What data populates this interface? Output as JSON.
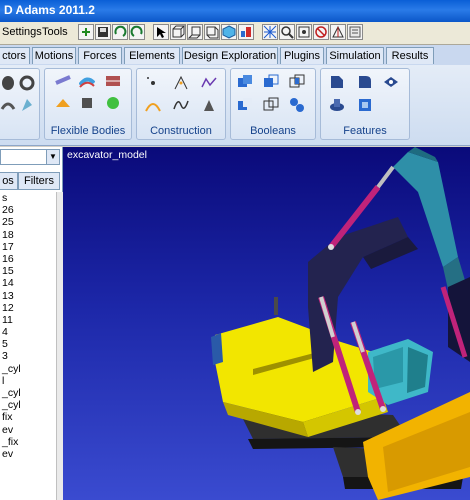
{
  "window": {
    "title": "D Adams 2011.2"
  },
  "menubar": {
    "settings_label": "Settings",
    "tools_label": "Tools"
  },
  "ribbon": {
    "tabs": [
      "ctors",
      "Motions",
      "Forces",
      "Elements",
      "Design Exploration",
      "Plugins",
      "Simulation",
      "Results"
    ],
    "groups": {
      "flexible_bodies": "Flexible Bodies",
      "construction": "Construction",
      "booleans": "Booleans",
      "features": "Features"
    }
  },
  "browser": {
    "dropdown_value": "",
    "tab_bodies": "os",
    "tab_filters": "Filters",
    "tree_items": [
      "s",
      "26",
      "25",
      "18",
      "17",
      "16",
      "15",
      "14",
      "13",
      "12",
      "11",
      "4",
      "5",
      "3",
      "_cyl",
      "l",
      "_cyl",
      "_cyl",
      "fix",
      "ev",
      "_fix",
      "ev"
    ]
  },
  "viewport": {
    "model_name": "excavator_model"
  },
  "colors": {
    "title_bar": "#0b56c8",
    "viewport_top": "#0a0a7a",
    "viewport_bottom": "#3a4bd0",
    "body_yellow": "#f2e600",
    "arm_navy": "#23234f",
    "cylinder_magenta": "#c0237a",
    "cabin_cyan": "#3fb8c8"
  }
}
